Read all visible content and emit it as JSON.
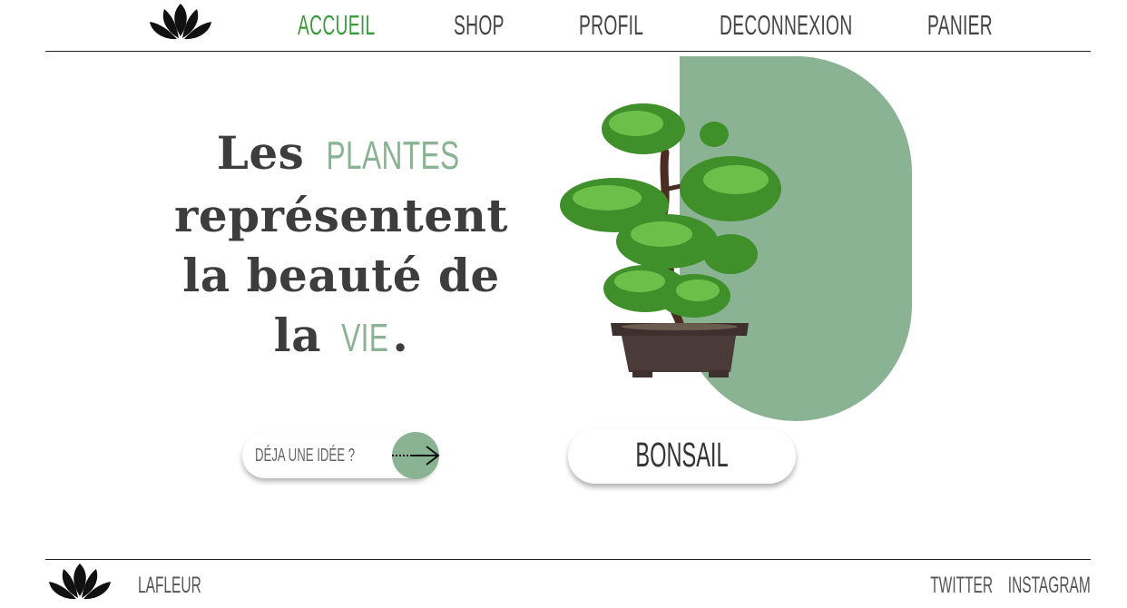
{
  "header": {
    "logo_icon": "lotus-icon",
    "nav": [
      {
        "label": "ACCUEIL",
        "active": true
      },
      {
        "label": "SHOP",
        "active": false
      },
      {
        "label": "PROFIL",
        "active": false
      },
      {
        "label": "DECONNEXION",
        "active": false
      },
      {
        "label": "PANIER",
        "active": false
      }
    ]
  },
  "hero": {
    "line1_prefix": "Les",
    "line1_accent": "PLANTES",
    "line2": "représentent",
    "line3": "la beauté de",
    "line4_prefix": "la",
    "line4_accent": "VIE",
    "line4_suffix": ".",
    "image_icon": "bonsai-plant-image"
  },
  "idea": {
    "label": "DÉJA UNE IDÉE ?",
    "button_icon": "arrow-right-icon"
  },
  "product_button": {
    "label": "BONSAIL"
  },
  "footer": {
    "logo_icon": "lotus-icon",
    "brand": "LAFLEUR",
    "links": [
      "TWITTER",
      "INSTAGRAM"
    ]
  },
  "colors": {
    "accent_green": "#8ab394",
    "active_nav": "#3b9a3b",
    "text": "#3d3d3d"
  }
}
